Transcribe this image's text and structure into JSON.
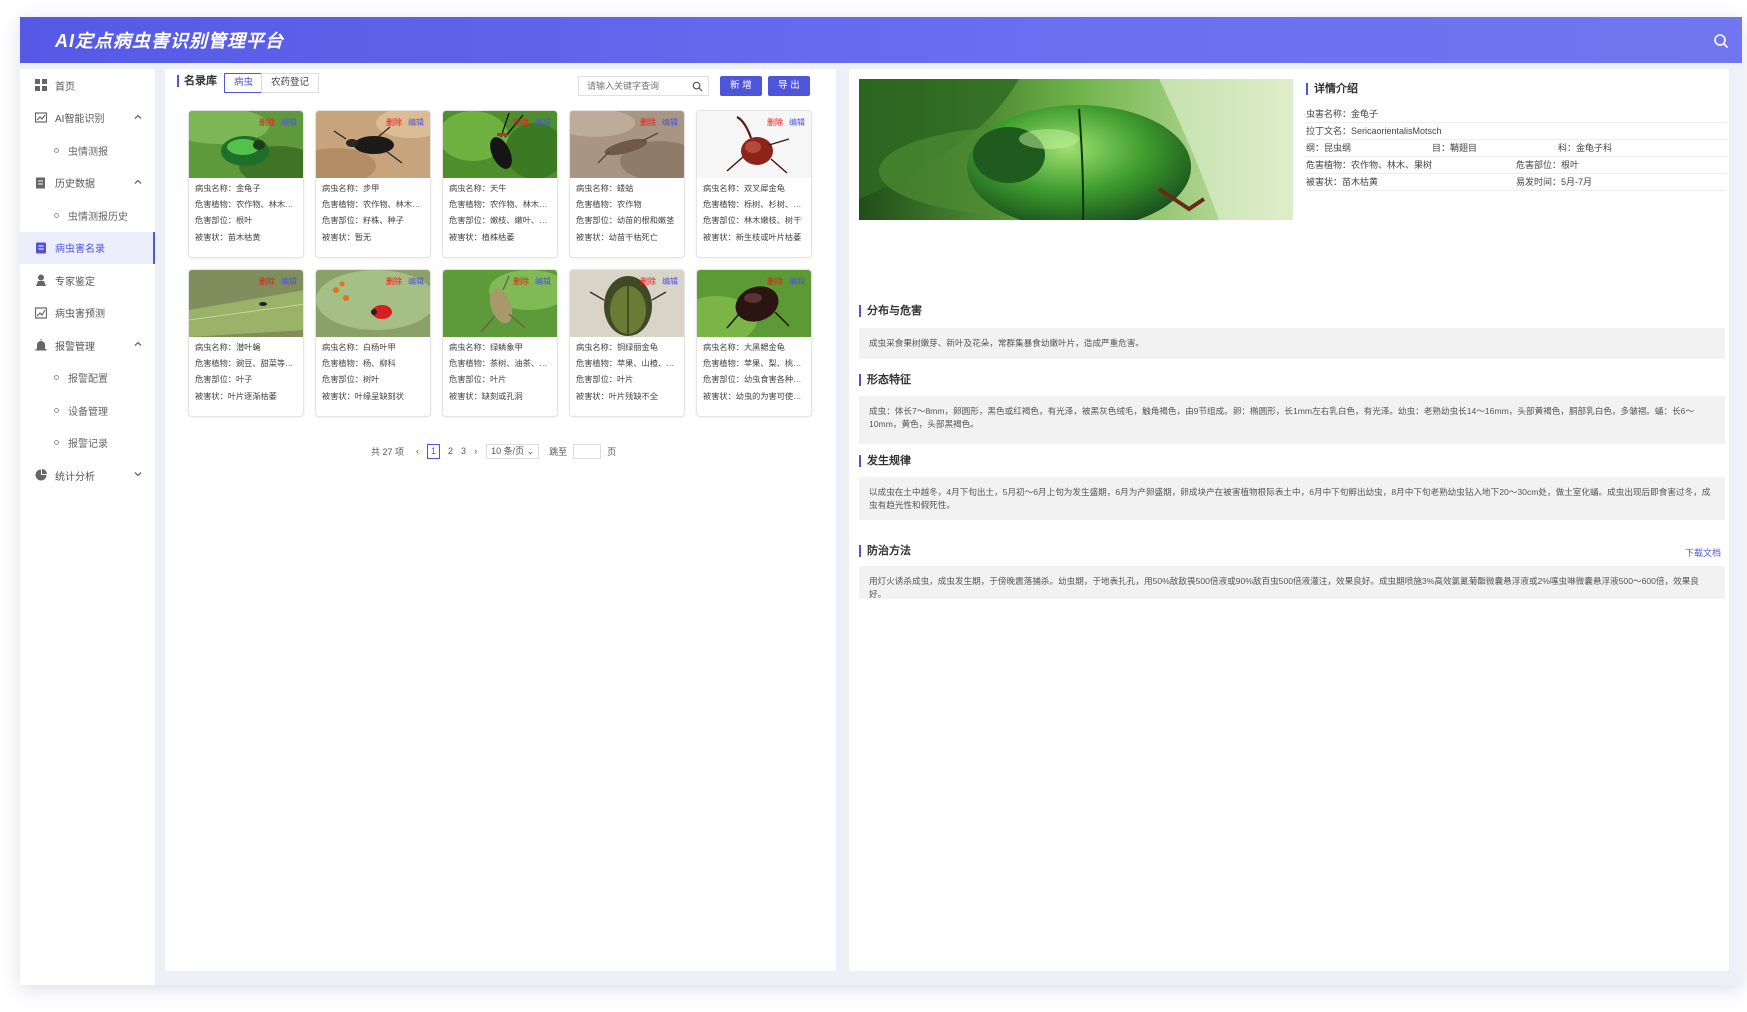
{
  "header": {
    "title": "AI定点病虫害识别管理平台"
  },
  "sidebar": {
    "items": [
      {
        "label": "首页"
      },
      {
        "label": "AI智能识别"
      },
      {
        "label": "虫情测报"
      },
      {
        "label": "历史数据"
      },
      {
        "label": "虫情测报历史"
      },
      {
        "label": "病虫害名录"
      },
      {
        "label": "专家鉴定"
      },
      {
        "label": "病虫害预测"
      },
      {
        "label": "报警管理"
      },
      {
        "label": "报警配置"
      },
      {
        "label": "设备管理"
      },
      {
        "label": "报警记录"
      },
      {
        "label": "统计分析"
      }
    ]
  },
  "library": {
    "title": "名录库",
    "tabs": [
      "病虫",
      "农药登记"
    ],
    "search_placeholder": "请输入关键字查询",
    "add_label": "新 增",
    "export_label": "导 出",
    "delete_label": "删除",
    "edit_label": "编辑",
    "cards": [
      {
        "name": "病虫名称：金龟子",
        "plant": "危害植物：农作物、林木、果树",
        "part": "危害部位：根叶",
        "symptom": "被害状：苗木枯黄"
      },
      {
        "name": "病虫名称：步甲",
        "plant": "危害植物：农作物、林木、果树",
        "part": "危害部位：籽株、种子",
        "symptom": "被害状：暂无"
      },
      {
        "name": "病虫名称：天牛",
        "plant": "危害植物：农作物、林木、果树",
        "part": "危害部位：嫩枝、嫩叶、树干",
        "symptom": "被害状：植株枯萎"
      },
      {
        "name": "病虫名称：蝼蛄",
        "plant": "危害植物：农作物",
        "part": "危害部位：幼苗的根和嫩茎",
        "symptom": "被害状：幼苗干枯死亡"
      },
      {
        "name": "病虫名称：双叉犀金龟",
        "plant": "危害植物：栎树、杉树、榆树",
        "part": "危害部位：林木嫩枝、树干",
        "symptom": "被害状：新生枝或叶片枯萎"
      },
      {
        "name": "病虫名称：潜叶蝇",
        "plant": "危害植物：豌豆、甜菜等蔬菜",
        "part": "危害部位：叶子",
        "symptom": "被害状：叶片逐渐枯萎"
      },
      {
        "name": "病虫名称：白杨叶甲",
        "plant": "危害植物：杨、柳科",
        "part": "危害部位：树叶",
        "symptom": "被害状：叶缘呈缺刻状"
      },
      {
        "name": "病虫名称：绿鳞象甲",
        "plant": "危害植物：茶树、油茶、柑橘",
        "part": "危害部位：叶片",
        "symptom": "被害状：缺刻或孔洞"
      },
      {
        "name": "病虫名称：铜绿丽金龟",
        "plant": "危害植物：苹果、山楂、海棠",
        "part": "危害部位：叶片",
        "symptom": "被害状：叶片残缺不全"
      },
      {
        "name": "病虫名称：大黑鳃金龟",
        "plant": "危害植物：苹果、梨、桃等果树",
        "part": "危害部位：幼虫食害各种作物",
        "symptom": "被害状：幼虫的为害可使幼苗枯死"
      }
    ],
    "pagination": {
      "total": "共 27 项",
      "pages": [
        "1",
        "2",
        "3"
      ],
      "page_size": "10 条/页",
      "jump_label": "跳至",
      "page_suffix": "页"
    }
  },
  "detail": {
    "title": "详情介绍",
    "rows": [
      {
        "a": "虫害名称：金龟子"
      },
      {
        "a": "拉丁文名：SericaorientalisMotsch"
      },
      {
        "a": "纲：昆虫纲",
        "b": "目：鞘翅目",
        "c": "科：金龟子科"
      },
      {
        "a": "危害植物：农作物、林木、果树",
        "b": "危害部位：根叶"
      },
      {
        "a": "被害状：苗木枯黄",
        "b": "易发时间：5月-7月"
      }
    ],
    "sections": [
      {
        "title": "分布与危害",
        "text": "成虫采食果树嫩芽、新叶及花朵，常群集暴食幼嫩叶片，造成严重危害。"
      },
      {
        "title": "形态特征",
        "text": "成虫：体长7～8mm，卵圆形，黑色或红褐色，有光泽，被黑灰色绒毛，触角褐色，由9节组成。卵：椭圆形，长1mm左右乳白色，有光泽。幼虫：老熟幼虫长14～16mm，头部黄褐色，胴部乳白色，多皱褶。蛹：长6～10mm，黄色，头部黑褐色。"
      },
      {
        "title": "发生规律",
        "text": "以成虫在土中越冬，4月下旬出土，5月初～6月上旬为发生盛期，6月为产卵盛期，卵成块产在被害植物根际表土中，6月中下旬孵出幼虫，8月中下旬老熟幼虫钻入地下20～30cm处，做土室化蛹。成虫出现后即食害过冬，成虫有趋光性和假死性。"
      },
      {
        "title": "防治方法",
        "text": "用灯火诱杀成虫，成虫发生期，于傍晚震落捕杀。幼虫期，于地表扎孔，用50%敌敌畏500倍液或90%敌百虫500倍液灌注，效果良好。成虫期喷施3%高效氯氰菊酯微囊悬浮液或2%噻虫啉微囊悬浮液500～600倍，效果良好。"
      }
    ],
    "download_label": "下载文档"
  },
  "colors": {
    "accent": "#4f55d9",
    "header_start": "#5559e6",
    "danger": "#f21616"
  }
}
